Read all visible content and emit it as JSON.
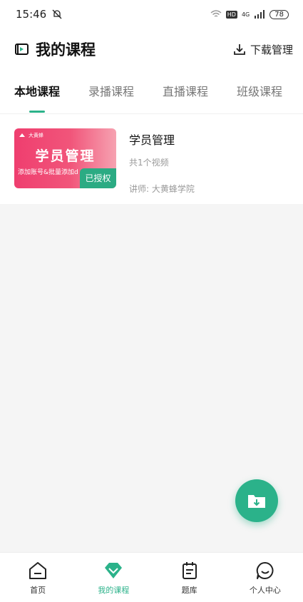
{
  "status_bar": {
    "time": "15:46",
    "battery": "78",
    "network": "4G",
    "hd": "HD"
  },
  "header": {
    "title": "我的课程",
    "download_label": "下载管理"
  },
  "tabs": [
    {
      "label": "本地课程",
      "active": true
    },
    {
      "label": "录播课程",
      "active": false
    },
    {
      "label": "直播课程",
      "active": false
    },
    {
      "label": "班级课程",
      "active": false
    }
  ],
  "course": {
    "thumb_brand": "大黄蜂",
    "thumb_title": "学员管理",
    "thumb_subtitle": "添加账号&批量添加d",
    "badge": "已授权",
    "name": "学员管理",
    "count": "共1个视频",
    "teacher": "讲师: 大黄蜂学院"
  },
  "bottom_nav": [
    {
      "label": "首页",
      "icon": "home-icon",
      "active": false
    },
    {
      "label": "我的课程",
      "icon": "gem-icon",
      "active": true
    },
    {
      "label": "题库",
      "icon": "notepad-icon",
      "active": false
    },
    {
      "label": "个人中心",
      "icon": "smiley-icon",
      "active": false
    }
  ],
  "colors": {
    "accent": "#2bb28a",
    "thumb_pink": "#ef3e6f"
  }
}
